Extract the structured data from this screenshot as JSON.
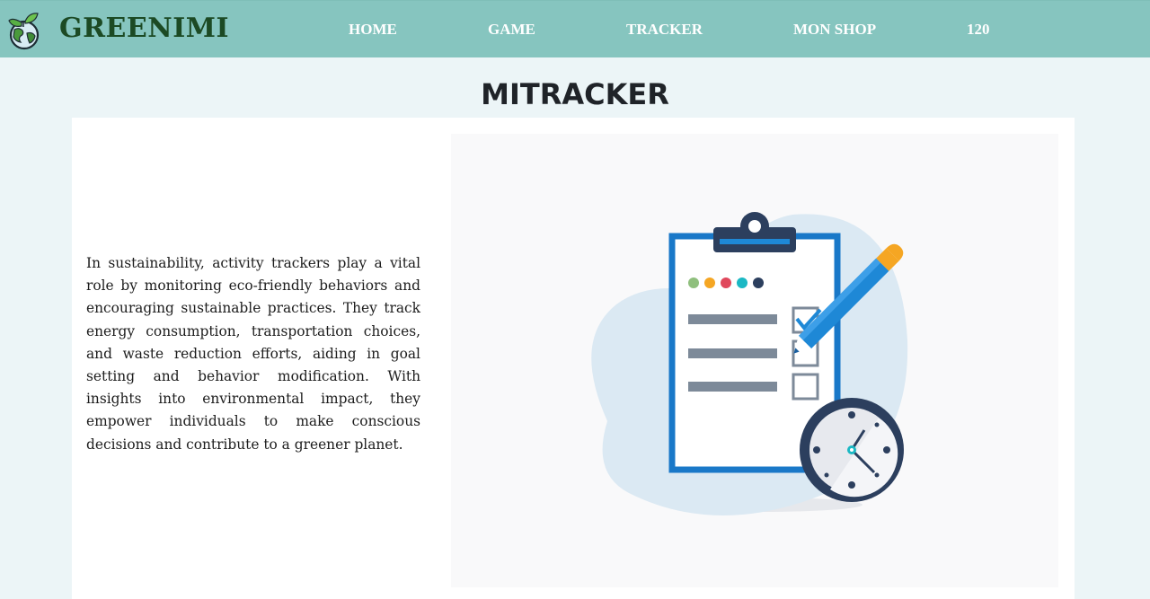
{
  "nav": {
    "brand": "GREENIMI",
    "items": [
      {
        "label": "HOME"
      },
      {
        "label": "GAME"
      },
      {
        "label": "TRACKER"
      },
      {
        "label": "MON SHOP"
      },
      {
        "label": "120"
      }
    ]
  },
  "main": {
    "title": "MITRACKER",
    "description": "In sustainability, activity trackers play a vital role by monitoring eco-friendly behaviors and encouraging sustainable practices. They track energy consumption, transportation choices, and waste reduction efforts, aiding in goal setting and behavior modification. With insights into environmental impact, they empower individuals to make conscious decisions and contribute to a greener planet."
  },
  "icons": {
    "logo": "globe-leaves-icon",
    "illustration": "clipboard-checklist-clock-illustration"
  },
  "colors": {
    "navbar": "#86c5bf",
    "brand_text": "#1c4a24",
    "page_bg": "#ecf5f7",
    "card_bg": "#ffffff",
    "clipboard_blue": "#1e88d6",
    "clock_navy": "#2c3f5e",
    "pencil_orange": "#f5a623"
  }
}
